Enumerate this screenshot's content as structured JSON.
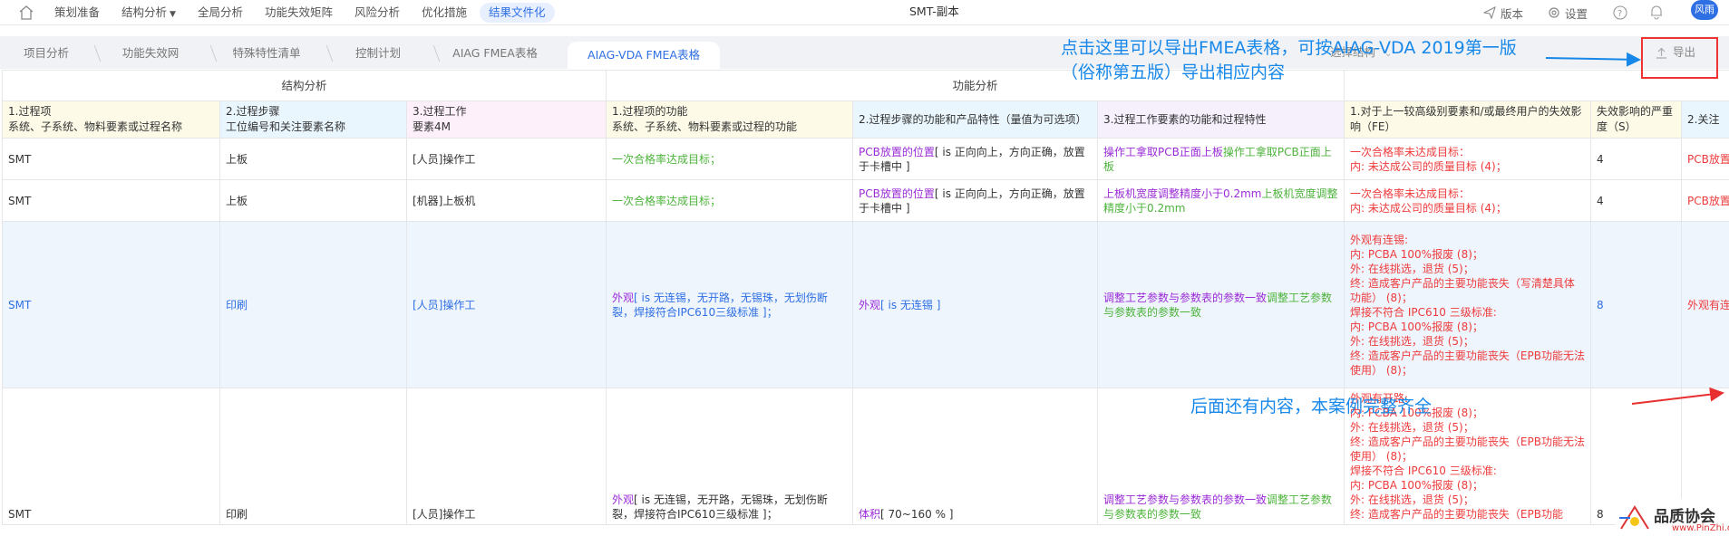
{
  "topbar": {
    "nav": [
      "策划准备",
      "结构分析",
      "全局分析",
      "功能失效矩阵",
      "风险分析",
      "优化措施",
      "结果文件化"
    ],
    "active_index": 6,
    "title": "SMT-副本",
    "version": "版本",
    "settings": "设置",
    "user": "风雨"
  },
  "tabs": [
    "项目分析",
    "功能失效网",
    "特殊特性清单",
    "控制计划",
    "AIAG FMEA表格",
    "AIAG-VDA FMEA表格"
  ],
  "active_tab": 5,
  "toolbar": {
    "select_structure": "选择结构",
    "export": "导出"
  },
  "table": {
    "groups": {
      "structure": "结构分析",
      "function": "功能分析"
    },
    "headers": [
      "1.过程项\n系统、子系统、物料要素或过程名称",
      "2.过程步骤\n工位编号和关注要素名称",
      "3.过程工作\n要素4M",
      "1.过程项的功能\n系统、子系统、物料要素或过程的功能",
      "2.过程步骤的功能和产品特性（量值为可选项）",
      "3.过程工作要素的功能和过程特性",
      "1.对于上一较高级别要素和/或最终用户的失效影响（FE）",
      "失效影响的严重度（S）",
      "2.关注"
    ],
    "rows": [
      {
        "item": "SMT",
        "step": "上板",
        "element": "[人员]操作工",
        "func_item": "一次合格率达成目标；",
        "func_step_name": "PCB放置的位置",
        "func_step_spec": "[ is 正向向上，方向正确，放置于卡槽中 ]",
        "func_elem": "操作工拿取PCB正面上板",
        "func_elem_2": "操作工拿取PCB正面上板",
        "fe_lines": [
          "一次合格率未达成目标：",
          "内: 未达成公司的质量目标 (4)；"
        ],
        "severity": "4",
        "last": "PCB放置"
      },
      {
        "item": "SMT",
        "step": "上板",
        "element": "[机器]上板机",
        "func_item": "一次合格率达成目标；",
        "func_step_name": "PCB放置的位置",
        "func_step_spec": "[ is 正向向上，方向正确，放置于卡槽中 ]",
        "func_elem": "上板机宽度调整精度小于0.2mm",
        "func_elem_2": "上板机宽度调整精度小于0.2mm",
        "fe_lines": [
          "一次合格率未达成目标：",
          "内: 未达成公司的质量目标 (4)；"
        ],
        "severity": "4",
        "last": "PCB放置"
      },
      {
        "item": "SMT",
        "step": "印刷",
        "element": "[人员]操作工",
        "func_item_name": "外观",
        "func_item_spec": "[ is 无连锡，无开路，无锡珠，无划伤断裂，焊接符合IPC610三级标准 ]；",
        "func_step_name": "外观",
        "func_step_spec": "[ is 无连锡 ]",
        "func_elem": "调整工艺参数与参数表的参数一致",
        "func_elem_2": "调整工艺参数与参数表的参数一致",
        "fe_lines": [
          "外观有连锡:",
          "内: PCBA 100%报废 (8)；",
          "外: 在线挑选，退货 (5)；",
          "终: 造成客户产品的主要功能丧失（写清楚具体功能） (8)；",
          "焊接不符合 IPC610 三级标准:",
          "内: PCBA 100%报废 (8)；",
          "外: 在线挑选，退货 (5)；",
          "终: 造成客户产品的主要功能丧失（EPB功能无法使用） (8)；"
        ],
        "severity": "8",
        "last": "外观有连"
      },
      {
        "item": "SMT",
        "step": "印刷",
        "element": "[人员]操作工",
        "func_item_name": "外观",
        "func_item_spec": "[ is 无连锡，无开路，无锡珠，无划伤断裂，焊接符合IPC610三级标准 ]；",
        "func_step_name": "体积",
        "func_step_spec": "[ 70~160 % ]",
        "func_elem": "调整工艺参数与参数表的参数一致",
        "func_elem_2": "调整工艺参数与参数表的参数一致",
        "fe_lines": [
          "外观有开路:",
          "内: PCBA 100%报废 (8)；",
          "外: 在线挑选，退货 (5)；",
          "终: 造成客户产品的主要功能丧失（EPB功能无法使用） (8)；",
          "焊接不符合 IPC610 三级标准:",
          "内: PCBA 100%报废 (8)；",
          "外: 在线挑选，退货 (5)；",
          "终: 造成客户产品的主要功能丧失（EPB功能"
        ],
        "severity": "8",
        "last": ""
      }
    ]
  },
  "annotations": {
    "export_note": "点击这里可以导出FMEA表格，可按AIAG-VDA 2019第一版（俗称第五版）导出相应内容",
    "more_note": "后面还有内容，本案例完整齐全"
  },
  "watermark": {
    "name": "品质协会",
    "url": "www.PinZhi.org"
  },
  "colors": {
    "accent": "#2f6fe4",
    "annotation": "#1788e9",
    "red": "#ee3b3b",
    "green": "#4db33b",
    "purple": "#9b2cd7"
  }
}
